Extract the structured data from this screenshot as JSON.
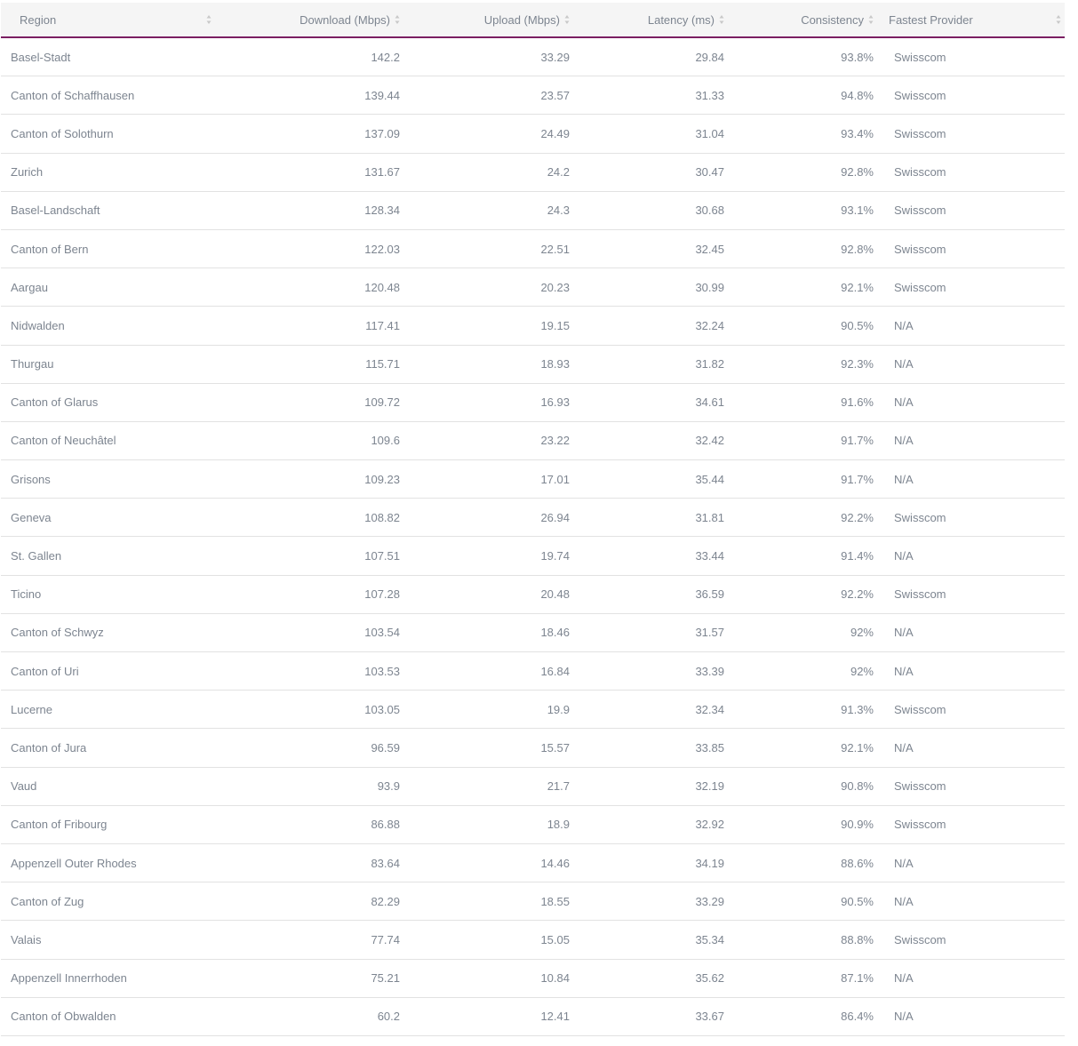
{
  "table": {
    "columns": [
      {
        "key": "region",
        "label": "Region"
      },
      {
        "key": "download",
        "label": "Download (Mbps)"
      },
      {
        "key": "upload",
        "label": "Upload (Mbps)"
      },
      {
        "key": "latency",
        "label": "Latency (ms)"
      },
      {
        "key": "consistency",
        "label": "Consistency"
      },
      {
        "key": "provider",
        "label": "Fastest Provider"
      }
    ],
    "rows": [
      {
        "region": "Basel-Stadt",
        "download": "142.2",
        "upload": "33.29",
        "latency": "29.84",
        "consistency": "93.8%",
        "provider": "Swisscom"
      },
      {
        "region": "Canton of Schaffhausen",
        "download": "139.44",
        "upload": "23.57",
        "latency": "31.33",
        "consistency": "94.8%",
        "provider": "Swisscom"
      },
      {
        "region": "Canton of Solothurn",
        "download": "137.09",
        "upload": "24.49",
        "latency": "31.04",
        "consistency": "93.4%",
        "provider": "Swisscom"
      },
      {
        "region": "Zurich",
        "download": "131.67",
        "upload": "24.2",
        "latency": "30.47",
        "consistency": "92.8%",
        "provider": "Swisscom"
      },
      {
        "region": "Basel-Landschaft",
        "download": "128.34",
        "upload": "24.3",
        "latency": "30.68",
        "consistency": "93.1%",
        "provider": "Swisscom"
      },
      {
        "region": "Canton of Bern",
        "download": "122.03",
        "upload": "22.51",
        "latency": "32.45",
        "consistency": "92.8%",
        "provider": "Swisscom"
      },
      {
        "region": "Aargau",
        "download": "120.48",
        "upload": "20.23",
        "latency": "30.99",
        "consistency": "92.1%",
        "provider": "Swisscom"
      },
      {
        "region": "Nidwalden",
        "download": "117.41",
        "upload": "19.15",
        "latency": "32.24",
        "consistency": "90.5%",
        "provider": "N/A"
      },
      {
        "region": "Thurgau",
        "download": "115.71",
        "upload": "18.93",
        "latency": "31.82",
        "consistency": "92.3%",
        "provider": "N/A"
      },
      {
        "region": "Canton of Glarus",
        "download": "109.72",
        "upload": "16.93",
        "latency": "34.61",
        "consistency": "91.6%",
        "provider": "N/A"
      },
      {
        "region": "Canton of Neuchâtel",
        "download": "109.6",
        "upload": "23.22",
        "latency": "32.42",
        "consistency": "91.7%",
        "provider": "N/A"
      },
      {
        "region": "Grisons",
        "download": "109.23",
        "upload": "17.01",
        "latency": "35.44",
        "consistency": "91.7%",
        "provider": "N/A"
      },
      {
        "region": "Geneva",
        "download": "108.82",
        "upload": "26.94",
        "latency": "31.81",
        "consistency": "92.2%",
        "provider": "Swisscom"
      },
      {
        "region": "St. Gallen",
        "download": "107.51",
        "upload": "19.74",
        "latency": "33.44",
        "consistency": "91.4%",
        "provider": "N/A"
      },
      {
        "region": "Ticino",
        "download": "107.28",
        "upload": "20.48",
        "latency": "36.59",
        "consistency": "92.2%",
        "provider": "Swisscom"
      },
      {
        "region": "Canton of Schwyz",
        "download": "103.54",
        "upload": "18.46",
        "latency": "31.57",
        "consistency": "92%",
        "provider": "N/A"
      },
      {
        "region": "Canton of Uri",
        "download": "103.53",
        "upload": "16.84",
        "latency": "33.39",
        "consistency": "92%",
        "provider": "N/A"
      },
      {
        "region": "Lucerne",
        "download": "103.05",
        "upload": "19.9",
        "latency": "32.34",
        "consistency": "91.3%",
        "provider": "Swisscom"
      },
      {
        "region": "Canton of Jura",
        "download": "96.59",
        "upload": "15.57",
        "latency": "33.85",
        "consistency": "92.1%",
        "provider": "N/A"
      },
      {
        "region": "Vaud",
        "download": "93.9",
        "upload": "21.7",
        "latency": "32.19",
        "consistency": "90.8%",
        "provider": "Swisscom"
      },
      {
        "region": "Canton of Fribourg",
        "download": "86.88",
        "upload": "18.9",
        "latency": "32.92",
        "consistency": "90.9%",
        "provider": "Swisscom"
      },
      {
        "region": "Appenzell Outer Rhodes",
        "download": "83.64",
        "upload": "14.46",
        "latency": "34.19",
        "consistency": "88.6%",
        "provider": "N/A"
      },
      {
        "region": "Canton of Zug",
        "download": "82.29",
        "upload": "18.55",
        "latency": "33.29",
        "consistency": "90.5%",
        "provider": "N/A"
      },
      {
        "region": "Valais",
        "download": "77.74",
        "upload": "15.05",
        "latency": "35.34",
        "consistency": "88.8%",
        "provider": "Swisscom"
      },
      {
        "region": "Appenzell Innerrhoden",
        "download": "75.21",
        "upload": "10.84",
        "latency": "35.62",
        "consistency": "87.1%",
        "provider": "N/A"
      },
      {
        "region": "Canton of Obwalden",
        "download": "60.2",
        "upload": "12.41",
        "latency": "33.67",
        "consistency": "86.4%",
        "provider": "N/A"
      }
    ]
  },
  "colors": {
    "header_bg": "#f5f5f5",
    "header_border": "#7b1f62",
    "text": "#7d8590",
    "row_border": "#e2e2e2"
  },
  "icons": {
    "sort": "sort-updown-icon"
  }
}
